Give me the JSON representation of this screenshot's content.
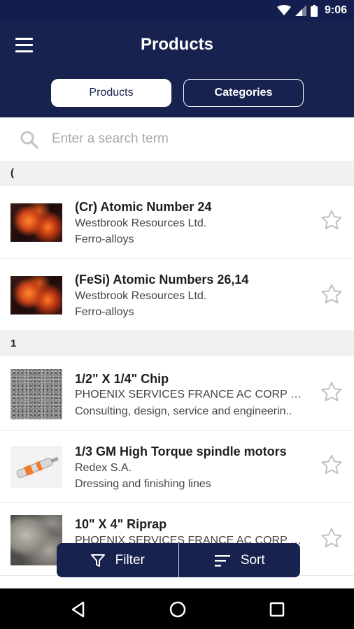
{
  "status_bar": {
    "time": "9:06",
    "icons": [
      "wifi-icon",
      "signal-icon",
      "battery-icon"
    ]
  },
  "header": {
    "title": "Products",
    "tabs": [
      {
        "label": "Products",
        "selected": true
      },
      {
        "label": "Categories",
        "selected": false
      }
    ]
  },
  "search": {
    "placeholder": "Enter a search term",
    "value": ""
  },
  "sections": [
    {
      "header": "(",
      "items": [
        {
          "title": "(Cr) Atomic Number 24",
          "company": "Westbrook Resources Ltd.",
          "category": "Ferro-alloys",
          "thumbnail": "fire",
          "favorite": false
        },
        {
          "title": "(FeSi) Atomic Numbers 26,14",
          "company": "Westbrook Resources Ltd.",
          "category": "Ferro-alloys",
          "thumbnail": "fire",
          "favorite": false
        }
      ]
    },
    {
      "header": "1",
      "items": [
        {
          "title": "1/2\" X 1/4\" Chip",
          "company": "PHOENIX SERVICES FRANCE AC CORP L...",
          "category": "Consulting, design, service and engineerin..",
          "thumbnail": "gravel",
          "favorite": false
        },
        {
          "title": "1/3 GM High Torque spindle motors",
          "company": "Redex S.A.",
          "category": "Dressing and finishing lines",
          "thumbnail": "motor",
          "favorite": false
        },
        {
          "title": "10\" X 4\" Riprap",
          "company": "PHOENIX SERVICES FRANCE AC CORP L...",
          "category": "",
          "thumbnail": "rock",
          "favorite": false
        }
      ]
    }
  ],
  "actions": {
    "filter_label": "Filter",
    "sort_label": "Sort"
  },
  "colors": {
    "primary": "#17224f",
    "status_bar": "#141e4e",
    "section_bg": "#f1f1f1",
    "star": "#bdbdbd"
  }
}
